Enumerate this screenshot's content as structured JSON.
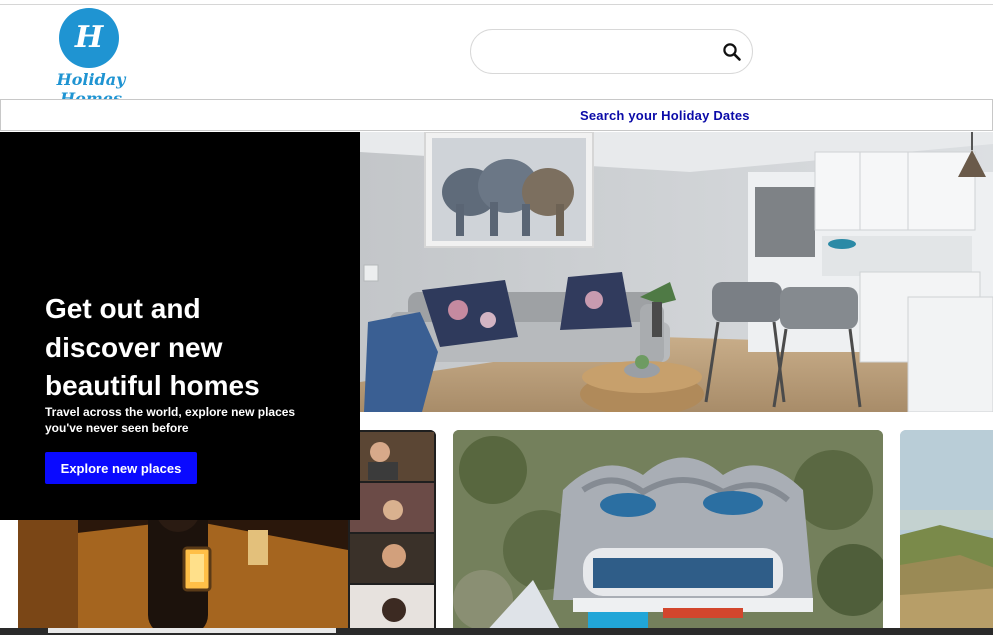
{
  "header": {
    "logo_text": "Holiday Homes",
    "logo_letter": "H",
    "search": {
      "value": "",
      "placeholder": ""
    },
    "dates_link": "Search your Holiday Dates"
  },
  "hero": {
    "title": "Get out and\ndiscover new\nbeautiful homes",
    "subtitle": "Travel across the world, explore new places\nyou've never seen before",
    "button_label": "Explore new places"
  },
  "colors": {
    "brand_blue": "#1f94d2",
    "link_blue": "#0a0aa8",
    "button_blue": "#0a0aff",
    "hero_panel": "#000000"
  },
  "icons": {
    "search": "search-icon",
    "logo": "logo-icon"
  },
  "cards": [
    {
      "name": "card-candle-room"
    },
    {
      "name": "card-wave-house"
    },
    {
      "name": "card-beach-dunes"
    }
  ]
}
